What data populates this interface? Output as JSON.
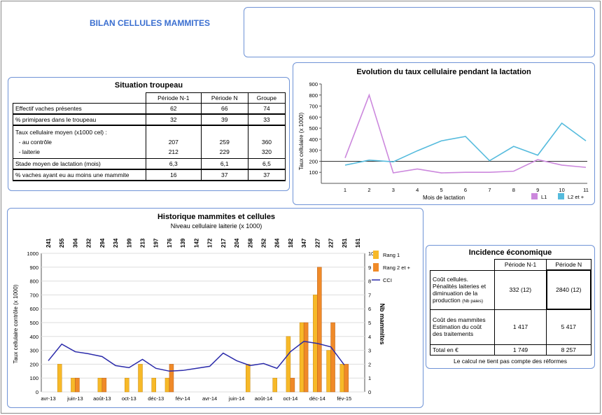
{
  "report_title": "BILAN CELLULES MAMMITES",
  "situation": {
    "title": "Situation troupeau",
    "headers": [
      "Période N-1",
      "Période N",
      "Groupe"
    ],
    "rows": [
      {
        "label": "Effectif vaches présentes",
        "v": [
          "62",
          "66",
          "74"
        ]
      },
      {
        "label": "% primipares dans le troupeau",
        "v": [
          "32",
          "39",
          "33"
        ]
      },
      {
        "label": "Taux cellulaire moyen (x1000 cel) :",
        "v": [
          "",
          "",
          ""
        ]
      },
      {
        "label": "  - au contrôle",
        "v": [
          "207",
          "259",
          "360"
        ]
      },
      {
        "label": "  - laiterie",
        "v": [
          "212",
          "229",
          "320"
        ]
      },
      {
        "label": "Stade moyen de lactation (mois)",
        "v": [
          "6,3",
          "6,1",
          "6,5"
        ]
      },
      {
        "label": "% vaches ayant eu au moins une mammite",
        "v": [
          "16",
          "37",
          "37"
        ]
      }
    ]
  },
  "incidence": {
    "title": "Incidence économique",
    "headers": [
      "Période N-1",
      "Période N"
    ],
    "row1_label": "Coût cellules. Pénalités laiteries et diminuation de la production",
    "row1_note": "(Nb paies)",
    "row1_v": [
      "332 (12)",
      "2840 (12)"
    ],
    "row2_label": "Coût des mammites Estimation du coût des traitements",
    "row2_v": [
      "1 417",
      "5 417"
    ],
    "total_label": "Total en €",
    "total_v": [
      "1 749",
      "8 257"
    ],
    "footnote": "Le calcul ne tient pas compte des réformes"
  },
  "chart_data": [
    {
      "type": "line",
      "title": "Evolution du taux cellulaire pendant la lactation",
      "xlabel": "Mois de lactation",
      "ylabel": "Taux cellulaire (x 1000)",
      "x": [
        1,
        2,
        3,
        4,
        5,
        6,
        7,
        8,
        9,
        10,
        11
      ],
      "ylim": [
        0,
        900
      ],
      "yticks": [
        100,
        200,
        300,
        400,
        500,
        600,
        700,
        800,
        900
      ],
      "reference_line": 200,
      "series": [
        {
          "name": "L1",
          "color": "#cc88dd",
          "values": [
            230,
            800,
            95,
            130,
            95,
            100,
            100,
            110,
            215,
            165,
            145
          ]
        },
        {
          "name": "L2 et +",
          "color": "#55bbdd",
          "values": [
            165,
            210,
            195,
            295,
            385,
            425,
            205,
            335,
            255,
            545,
            385
          ]
        }
      ]
    },
    {
      "type": "bar",
      "title": "Historique mammites et cellules",
      "subtitle": "Niveau cellulaire laiterie (x 1000)",
      "ylabel": "Taux cellulaire contrôle (x 1000)",
      "y2label": "Nb mammites",
      "ylim": [
        0,
        1000
      ],
      "y2lim": [
        0,
        10
      ],
      "yticks": [
        0,
        100,
        200,
        300,
        400,
        500,
        600,
        700,
        800,
        900,
        1000
      ],
      "x_labels": [
        "avr-13",
        "juin-13",
        "août-13",
        "oct-13",
        "déc-13",
        "fév-14",
        "avr-14",
        "juin-14",
        "août-14",
        "oct-14",
        "déc-14",
        "fév-15"
      ],
      "top_labels": [
        "241",
        "255",
        "304",
        "232",
        "294",
        "234",
        "199",
        "213",
        "197",
        "176",
        "139",
        "142",
        "172",
        "217",
        "204",
        "258",
        "252",
        "264",
        "182",
        "347",
        "227",
        "227",
        "251",
        "161"
      ],
      "series": [
        {
          "name": "Rang 1",
          "color": "#f7b928",
          "values": [
            0,
            2,
            1,
            0,
            1,
            0,
            1,
            2,
            1,
            1,
            0,
            0,
            0,
            0,
            0,
            2,
            0,
            1,
            4,
            5,
            7,
            3,
            2,
            0
          ]
        },
        {
          "name": "Rang 2 et +",
          "color": "#f08a28",
          "values": [
            0,
            0,
            1,
            0,
            1,
            0,
            0,
            0,
            0,
            2,
            0,
            0,
            0,
            0,
            0,
            0,
            0,
            0,
            1,
            5,
            9,
            5,
            2,
            0
          ]
        },
        {
          "name": "CCI",
          "color": "#2a2aaa",
          "values": [
            225,
            345,
            290,
            275,
            255,
            190,
            175,
            235,
            170,
            150,
            155,
            170,
            185,
            280,
            225,
            190,
            205,
            170,
            290,
            365,
            350,
            325,
            195
          ]
        }
      ]
    }
  ]
}
